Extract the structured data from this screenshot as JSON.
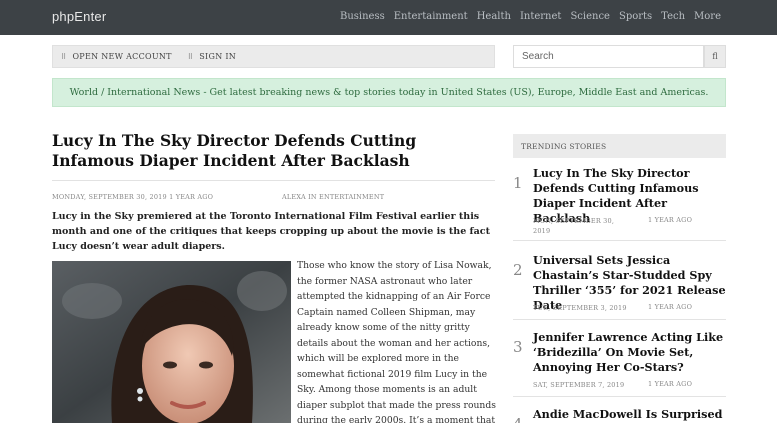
{
  "site": {
    "brand": "phpEnter"
  },
  "nav": [
    "Business",
    "Entertainment",
    "Health",
    "Internet",
    "Science",
    "Sports",
    "Tech",
    "More"
  ],
  "account": {
    "open_label": "OPEN NEW ACCOUNT",
    "signin_label": "SIGN IN",
    "open_icon": "user-icon",
    "signin_icon": "login-icon"
  },
  "search": {
    "placeholder": "Search",
    "button_label": "fl"
  },
  "banner": "World / International News - Get latest breaking news & top stories today in United States (US), Europe, Middle East and Americas.",
  "article": {
    "title": "Lucy In The Sky Director Defends Cutting Infamous Diaper Incident After Backlash",
    "date": "MONDAY, SEPTEMBER 30, 2019 1 YEAR AGO",
    "author": "ALEXA IN ENTERTAINMENT",
    "lead": "Lucy in the Sky premiered at the Toronto International Film Festival earlier this month and one of the critiques that keeps cropping up about the movie is the fact Lucy doesn’t wear adult diapers.",
    "body": "Those who know the story of Lisa Nowak, the former NASA astronaut who later attempted the kidnapping of an Air Force Captain named Colleen Shipman, may already know some of the nitty gritty details about the woman and her actions, which will be explored more in the somewhat fictional 2019 film Lucy in the Sky. Among those moments is an adult diaper subplot that made the press rounds during the early 2000s. It’s a moment that we now know also doesn’t appear in Lucy in the Sky. While Lucy"
  },
  "trending": {
    "heading": "TRENDING STORIES",
    "items": [
      {
        "num": "1",
        "title": "Lucy In The Sky Director Defends Cutting Infamous Diaper Incident After Backlash",
        "date": "MON, SEPTEMBER 30, 2019",
        "ago": "1 YEAR AGO"
      },
      {
        "num": "2",
        "title": "Universal Sets Jessica Chastain’s Star-Studded Spy Thriller ‘355’ for 2021 Release Date",
        "date": "TUE, SEPTEMBER 3, 2019",
        "ago": "1 YEAR AGO"
      },
      {
        "num": "3",
        "title": "Jennifer Lawrence Acting Like ‘Bridezilla’ On Movie Set, Annoying Her Co-Stars?",
        "date": "SAT, SEPTEMBER 7, 2019",
        "ago": "1 YEAR AGO"
      },
      {
        "num": "4",
        "title": "Andie MacDowell Is Surprised",
        "date": "",
        "ago": ""
      }
    ]
  },
  "colors": {
    "topbar": "#3d4246",
    "banner_bg": "#d6f0de",
    "banner_text": "#2e6b3f"
  }
}
